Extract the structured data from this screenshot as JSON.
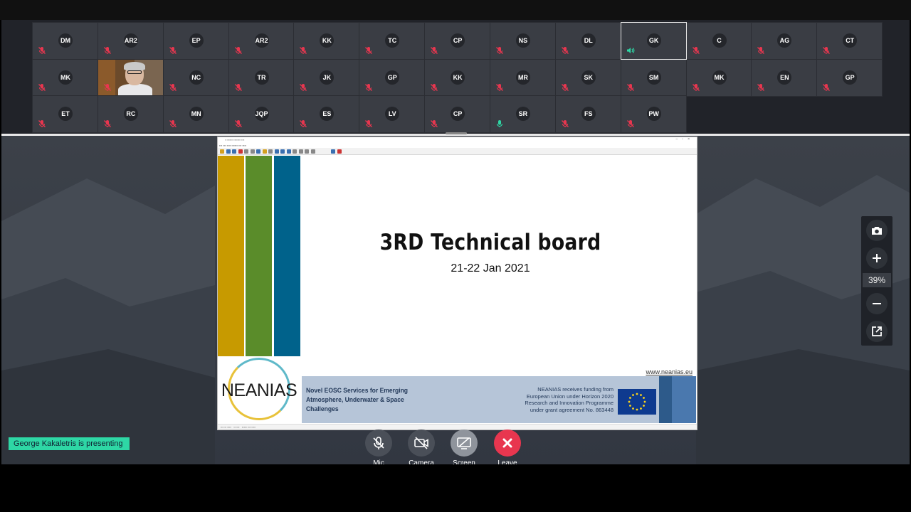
{
  "participants": [
    {
      "initials": "DM",
      "mic": "muted"
    },
    {
      "initials": "AR2",
      "mic": "muted"
    },
    {
      "initials": "EP",
      "mic": "muted"
    },
    {
      "initials": "AR2",
      "mic": "muted"
    },
    {
      "initials": "KK",
      "mic": "muted"
    },
    {
      "initials": "TC",
      "mic": "muted"
    },
    {
      "initials": "CP",
      "mic": "muted"
    },
    {
      "initials": "NS",
      "mic": "muted"
    },
    {
      "initials": "DL",
      "mic": "muted"
    },
    {
      "initials": "GK",
      "mic": "speaking",
      "active": true
    },
    {
      "initials": "C",
      "mic": "muted"
    },
    {
      "initials": "AG",
      "mic": "muted"
    },
    {
      "initials": "CT",
      "mic": "muted"
    },
    {
      "initials": "MK",
      "mic": "muted"
    },
    {
      "initials": "",
      "mic": "muted",
      "video": true
    },
    {
      "initials": "NC",
      "mic": "muted"
    },
    {
      "initials": "TR",
      "mic": "muted"
    },
    {
      "initials": "JK",
      "mic": "muted"
    },
    {
      "initials": "GP",
      "mic": "muted"
    },
    {
      "initials": "KK",
      "mic": "muted"
    },
    {
      "initials": "MR",
      "mic": "muted"
    },
    {
      "initials": "SK",
      "mic": "muted"
    },
    {
      "initials": "SM",
      "mic": "muted"
    },
    {
      "initials": "MK",
      "mic": "muted"
    },
    {
      "initials": "EN",
      "mic": "muted"
    },
    {
      "initials": "GP",
      "mic": "muted"
    },
    {
      "initials": "ET",
      "mic": "muted"
    },
    {
      "initials": "RC",
      "mic": "muted"
    },
    {
      "initials": "MN",
      "mic": "muted"
    },
    {
      "initials": "JQP",
      "mic": "muted"
    },
    {
      "initials": "ES",
      "mic": "muted"
    },
    {
      "initials": "LV",
      "mic": "muted"
    },
    {
      "initials": "CP",
      "mic": "muted"
    },
    {
      "initials": "SR",
      "mic": "on"
    },
    {
      "initials": "FS",
      "mic": "muted"
    },
    {
      "initials": "PW",
      "mic": "muted"
    }
  ],
  "slide": {
    "title": "3RD Technical board",
    "date": "21-22 Jan 2021",
    "logo_text": "NEANIAS",
    "url": "www.neanias.eu",
    "tagline": "Novel EOSC Services for Emerging Atmosphere, Underwater & Space Challenges",
    "funding": "NEANIAS receives funding from European Union under Horizon 2020 Research and Innovation Programme under grant agreement No. 863448",
    "bar_colors": [
      "#c79a00",
      "#5a8c2a",
      "#00628b"
    ]
  },
  "zoom": {
    "level": "39%"
  },
  "presenting_label": "George Kakaletris is presenting",
  "controls": [
    {
      "label": "Mic",
      "color": "#4a4f58"
    },
    {
      "label": "Camera",
      "color": "#4a4f58"
    },
    {
      "label": "Screen",
      "color": "#8f949c"
    },
    {
      "label": "Leave",
      "color": "#e8364f"
    }
  ],
  "colors": {
    "muted": "#e8364f",
    "speaking": "#2ed7a5",
    "presenting": "#2ed7a5"
  }
}
